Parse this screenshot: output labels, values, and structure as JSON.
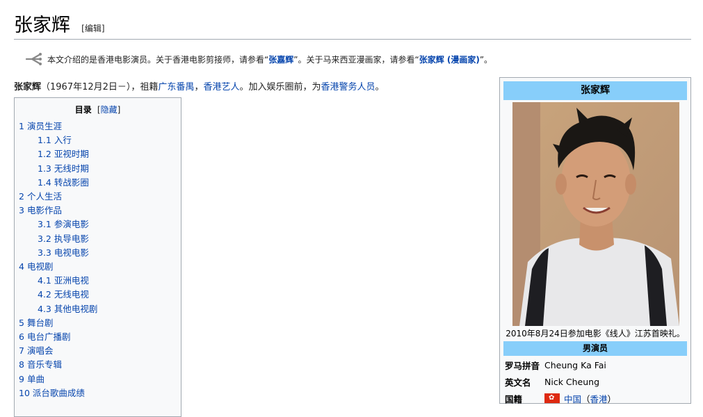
{
  "page": {
    "title": "张家辉",
    "edit_label": "[编辑]"
  },
  "hatnote": {
    "text_before": "本文介绍的是香港电影演员。关于香港电影剪接师，请参看“",
    "link1": "张嘉辉",
    "text_middle": "”。关于马来西亚漫画家，请参看“",
    "link2": "张家辉 (漫画家)",
    "text_after": "”。",
    "icon": "disambiguation-icon"
  },
  "lead": {
    "bold_name": "张家辉",
    "text1": "（1967年12月2日－），祖籍",
    "link1": "广东番禺",
    "sep": "，",
    "link2": "香港艺人",
    "text2": "。加入娱乐圈前，为",
    "link3": "香港警务人员",
    "text3": "。"
  },
  "toc": {
    "title": "目录",
    "hide_label": "隐藏",
    "items": [
      {
        "num": "1",
        "label": "演员生涯",
        "level": 1
      },
      {
        "num": "1.1",
        "label": "入行",
        "level": 2
      },
      {
        "num": "1.2",
        "label": "亚视时期",
        "level": 2
      },
      {
        "num": "1.3",
        "label": "无线时期",
        "level": 2
      },
      {
        "num": "1.4",
        "label": "转战影圈",
        "level": 2
      },
      {
        "num": "2",
        "label": "个人生活",
        "level": 1
      },
      {
        "num": "3",
        "label": "电影作品",
        "level": 1
      },
      {
        "num": "3.1",
        "label": "参演电影",
        "level": 2
      },
      {
        "num": "3.2",
        "label": "执导电影",
        "level": 2
      },
      {
        "num": "3.3",
        "label": "电视电影",
        "level": 2
      },
      {
        "num": "4",
        "label": "电视剧",
        "level": 1
      },
      {
        "num": "4.1",
        "label": "亚洲电视",
        "level": 2
      },
      {
        "num": "4.2",
        "label": "无线电视",
        "level": 2
      },
      {
        "num": "4.3",
        "label": "其他电视剧",
        "level": 2
      },
      {
        "num": "5",
        "label": "舞台剧",
        "level": 1
      },
      {
        "num": "6",
        "label": "电台广播剧",
        "level": 1
      },
      {
        "num": "7",
        "label": "演唱会",
        "level": 1
      },
      {
        "num": "8",
        "label": "音乐专辑",
        "level": 1
      },
      {
        "num": "9",
        "label": "单曲",
        "level": 1
      },
      {
        "num": "10",
        "label": "派台歌曲成绩",
        "level": 1
      }
    ]
  },
  "infobox": {
    "title": "张家辉",
    "caption": "2010年8月24日参加电影《线人》江苏首映礼。",
    "section": "男演员",
    "rows": [
      {
        "label": "罗马拼音",
        "value": "Cheung Ka Fai"
      },
      {
        "label": "英文名",
        "value": "Nick Cheung"
      },
      {
        "label": "国籍",
        "value_link1": "中国",
        "value_open": "（",
        "value_link2": "香港",
        "value_close": "）"
      }
    ]
  }
}
